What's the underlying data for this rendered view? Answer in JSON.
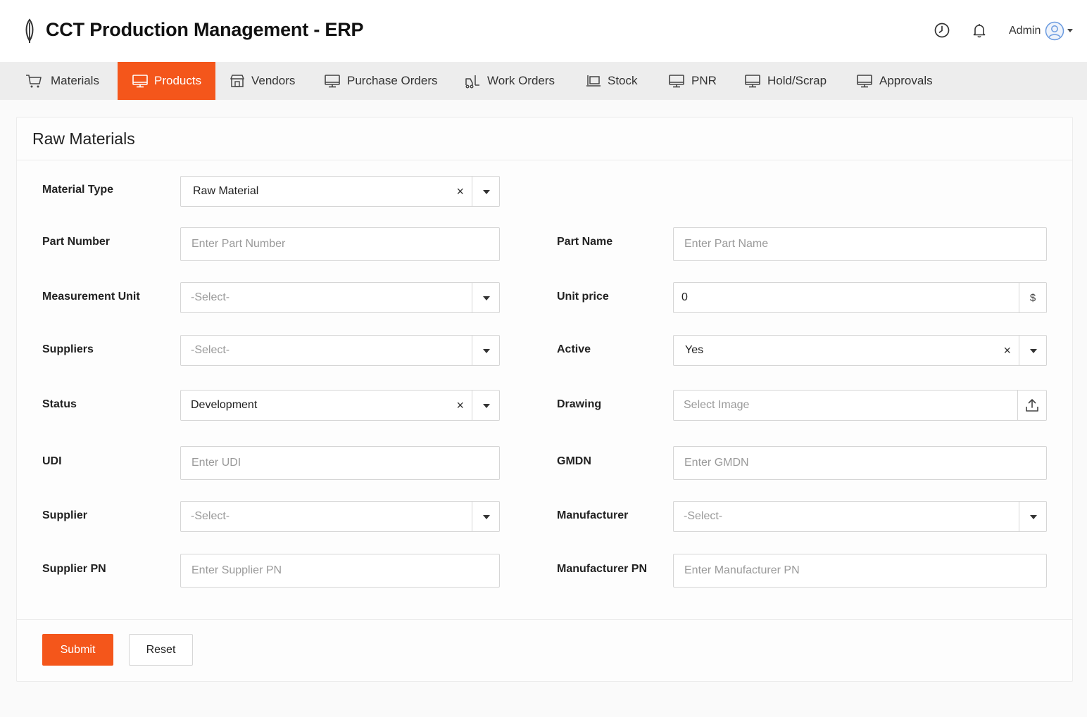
{
  "app": {
    "title": "CCT Production Management - ERP"
  },
  "header": {
    "user_label": "Admin",
    "icons": [
      "clock-icon",
      "bell-icon",
      "user-avatar-icon",
      "caret-down-icon"
    ]
  },
  "nav": {
    "items": [
      {
        "label": "Materials",
        "icon": "cart-icon",
        "active": false
      },
      {
        "label": "Products",
        "icon": "monitor-icon",
        "active": true
      },
      {
        "label": "Vendors",
        "icon": "store-icon",
        "active": false
      },
      {
        "label": "Purchase Orders",
        "icon": "monitor-icon",
        "active": false
      },
      {
        "label": "Work Orders",
        "icon": "forklift-icon",
        "active": false
      },
      {
        "label": "Stock",
        "icon": "pallet-icon",
        "active": false
      },
      {
        "label": "PNR",
        "icon": "monitor-icon",
        "active": false
      },
      {
        "label": "Hold/Scrap",
        "icon": "monitor-icon",
        "active": false
      },
      {
        "label": "Approvals",
        "icon": "monitor-icon",
        "active": false
      }
    ],
    "active_color": "#f4561b"
  },
  "form": {
    "title": "Raw Materials",
    "material_type": {
      "label": "Material Type",
      "value": "Raw Material"
    },
    "part_number": {
      "label": "Part Number",
      "placeholder": "Enter Part Number"
    },
    "part_name": {
      "label": "Part Name",
      "placeholder": "Enter Part Name"
    },
    "measurement_unit": {
      "label": "Measurement Unit",
      "value": "-Select-"
    },
    "unit_price": {
      "label": "Unit price",
      "value": "0",
      "addon": "$"
    },
    "suppliers": {
      "label": "Suppliers",
      "value": "-Select-"
    },
    "active": {
      "label": "Active",
      "value": "Yes"
    },
    "status": {
      "label": "Status",
      "value": "Development"
    },
    "drawing": {
      "label": "Drawing",
      "placeholder": "Select Image"
    },
    "udi": {
      "label": "UDI",
      "placeholder": "Enter UDI"
    },
    "gmdn": {
      "label": "GMDN",
      "placeholder": "Enter GMDN"
    },
    "supplier": {
      "label": "Supplier",
      "value": "-Select-"
    },
    "manufacturer": {
      "label": "Manufacturer",
      "value": "-Select-"
    },
    "supplier_pn": {
      "label": "Supplier PN",
      "placeholder": "Enter Supplier PN"
    },
    "manufacturer_pn": {
      "label": "Manufacturer PN",
      "placeholder": "Enter Manufacturer PN"
    },
    "clear_glyph": "×"
  },
  "buttons": {
    "submit": "Submit",
    "reset": "Reset"
  }
}
